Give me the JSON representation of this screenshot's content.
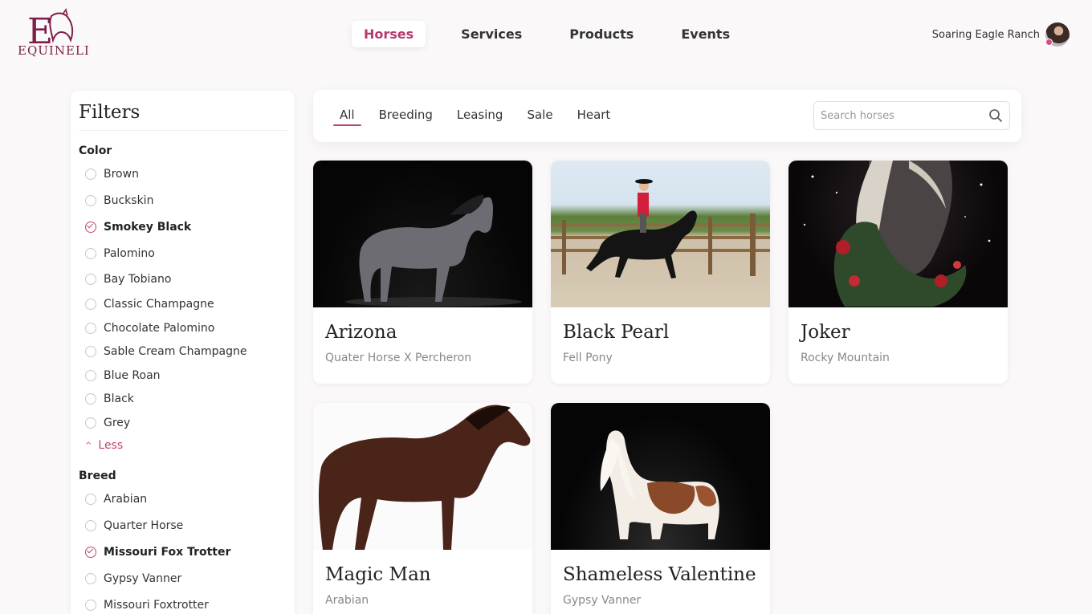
{
  "brand": {
    "name": "EQUINELI",
    "accent": "#b8396a"
  },
  "nav": {
    "items": [
      {
        "label": "Horses",
        "active": true
      },
      {
        "label": "Services",
        "active": false
      },
      {
        "label": "Products",
        "active": false
      },
      {
        "label": "Events",
        "active": false
      }
    ]
  },
  "user": {
    "name": "Soaring Eagle Ranch",
    "icon": "avatar"
  },
  "filters": {
    "title": "Filters",
    "color": {
      "title": "Color",
      "options": [
        {
          "label": "Brown",
          "checked": false
        },
        {
          "label": "Buckskin",
          "checked": false
        },
        {
          "label": "Smokey Black",
          "checked": true
        },
        {
          "label": "Palomino",
          "checked": false
        },
        {
          "label": "Bay Tobiano",
          "checked": false
        },
        {
          "label": "Classic Champagne",
          "checked": false
        },
        {
          "label": "Chocolate Palomino",
          "checked": false
        },
        {
          "label": "Sable Cream Champagne",
          "checked": false
        },
        {
          "label": "Blue Roan",
          "checked": false
        },
        {
          "label": "Black",
          "checked": false
        },
        {
          "label": "Grey",
          "checked": false
        }
      ],
      "less_label": "Less"
    },
    "breed": {
      "title": "Breed",
      "options": [
        {
          "label": "Arabian",
          "checked": false
        },
        {
          "label": "Quarter Horse",
          "checked": false
        },
        {
          "label": "Missouri Fox Trotter",
          "checked": true
        },
        {
          "label": "Gypsy Vanner",
          "checked": false
        },
        {
          "label": "Missouri Foxtrotter",
          "checked": false
        }
      ]
    }
  },
  "tabs": [
    {
      "label": "All",
      "active": true
    },
    {
      "label": "Breeding",
      "active": false
    },
    {
      "label": "Leasing",
      "active": false
    },
    {
      "label": "Sale",
      "active": false
    },
    {
      "label": "Heart",
      "active": false
    }
  ],
  "search": {
    "placeholder": "Search horses",
    "value": "",
    "icon": "search-icon"
  },
  "horses": [
    {
      "name": "Arizona",
      "breed": "Quater Horse X Percheron"
    },
    {
      "name": "Black Pearl",
      "breed": "Fell Pony"
    },
    {
      "name": "Joker",
      "breed": "Rocky Mountain"
    },
    {
      "name": "Magic Man",
      "breed": "Arabian"
    },
    {
      "name": "Shameless Valentine",
      "breed": "Gypsy Vanner"
    }
  ]
}
